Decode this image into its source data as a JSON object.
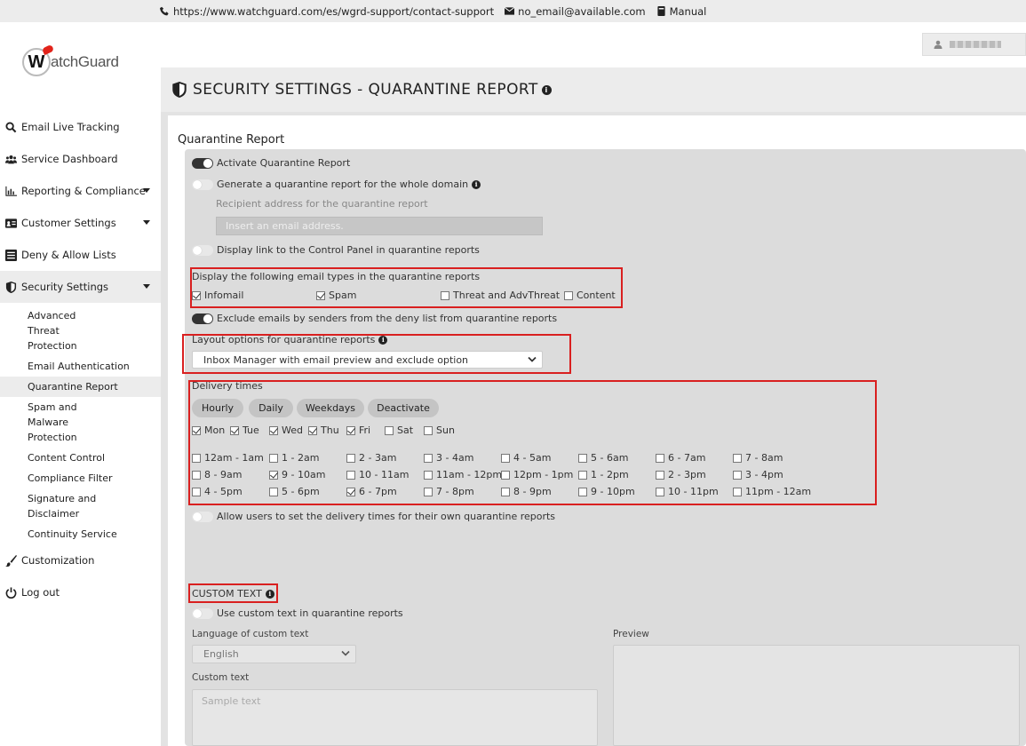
{
  "topbar": {
    "support_url": "https://www.watchguard.com/es/wgrd-support/contact-support",
    "email": "no_email@available.com",
    "manual": "Manual"
  },
  "logo": {
    "mark": "W",
    "text": "atchGuard"
  },
  "sidebar": {
    "items": [
      {
        "label": "Email Live Tracking",
        "icon": "search-icon"
      },
      {
        "label": "Service Dashboard",
        "icon": "users-icon"
      },
      {
        "label": "Reporting & Compliance",
        "icon": "chart-icon"
      },
      {
        "label": "Customer Settings",
        "icon": "id-card-icon"
      },
      {
        "label": "Deny & Allow Lists",
        "icon": "list-icon"
      },
      {
        "label": "Security Settings",
        "icon": "shield-icon"
      }
    ],
    "subitems": [
      "Advanced Threat Protection",
      "Email Authentication",
      "Quarantine Report",
      "Spam and Malware Protection",
      "Content Control",
      "Compliance Filter",
      "Signature and Disclaimer",
      "Continuity Service"
    ],
    "bottom": [
      {
        "label": "Customization",
        "icon": "brush-icon"
      },
      {
        "label": "Log out",
        "icon": "power-icon"
      }
    ]
  },
  "header": {
    "title": "SECURITY SETTINGS - QUARANTINE REPORT"
  },
  "card": {
    "title": "Quarantine Report"
  },
  "settings": {
    "activate": "Activate Quarantine Report",
    "whole_domain": "Generate a quarantine report for the whole domain",
    "recipient_label": "Recipient address for the quarantine report",
    "recipient_placeholder": "Insert an email address.",
    "display_link": "Display link to the Control Panel in quarantine reports",
    "email_types_label": "Display the following email types in the quarantine reports",
    "email_types": [
      {
        "label": "Infomail",
        "checked": true
      },
      {
        "label": "Spam",
        "checked": true
      },
      {
        "label": "Threat and AdvThreat",
        "checked": false
      },
      {
        "label": "Content",
        "checked": false
      }
    ],
    "exclude_deny": "Exclude emails by senders from the deny list from quarantine reports",
    "layout_label": "Layout options for quarantine reports",
    "layout_value": "Inbox Manager with email preview and exclude option",
    "delivery_label": "Delivery times",
    "delivery_buttons": [
      "Hourly",
      "Daily",
      "Weekdays",
      "Deactivate"
    ],
    "days": [
      {
        "label": "Mon",
        "checked": true
      },
      {
        "label": "Tue",
        "checked": true
      },
      {
        "label": "Wed",
        "checked": true
      },
      {
        "label": "Thu",
        "checked": true
      },
      {
        "label": "Fri",
        "checked": true
      },
      {
        "label": "Sat",
        "checked": false
      },
      {
        "label": "Sun",
        "checked": false
      }
    ],
    "times": [
      {
        "label": "12am - 1am",
        "checked": false
      },
      {
        "label": "1 - 2am",
        "checked": false
      },
      {
        "label": "2 - 3am",
        "checked": false
      },
      {
        "label": "3 - 4am",
        "checked": false
      },
      {
        "label": "4 - 5am",
        "checked": false
      },
      {
        "label": "5 - 6am",
        "checked": false
      },
      {
        "label": "6 - 7am",
        "checked": false
      },
      {
        "label": "7 - 8am",
        "checked": false
      },
      {
        "label": "8 - 9am",
        "checked": false
      },
      {
        "label": "9 - 10am",
        "checked": true
      },
      {
        "label": "10 - 11am",
        "checked": false
      },
      {
        "label": "11am - 12pm",
        "checked": false
      },
      {
        "label": "12pm - 1pm",
        "checked": false
      },
      {
        "label": "1 - 2pm",
        "checked": false
      },
      {
        "label": "2 - 3pm",
        "checked": false
      },
      {
        "label": "3 - 4pm",
        "checked": false
      },
      {
        "label": "4 - 5pm",
        "checked": false
      },
      {
        "label": "5 - 6pm",
        "checked": false
      },
      {
        "label": "6 - 7pm",
        "checked": true
      },
      {
        "label": "7 - 8pm",
        "checked": false
      },
      {
        "label": "8 - 9pm",
        "checked": false
      },
      {
        "label": "9 - 10pm",
        "checked": false
      },
      {
        "label": "10 - 11pm",
        "checked": false
      },
      {
        "label": "11pm - 12am",
        "checked": false
      }
    ],
    "allow_users": "Allow users to set the delivery times for their own quarantine reports",
    "custom_text_heading": "CUSTOM TEXT",
    "use_custom_text": "Use custom text in quarantine reports",
    "language_label": "Language of custom text",
    "language_value": "English",
    "custom_text_label": "Custom text",
    "custom_text_placeholder": "Sample text",
    "preview_label": "Preview"
  },
  "colors": {
    "highlight": "#d92020",
    "panel": "#dcdcdc",
    "sidebar_active": "#ececec"
  }
}
